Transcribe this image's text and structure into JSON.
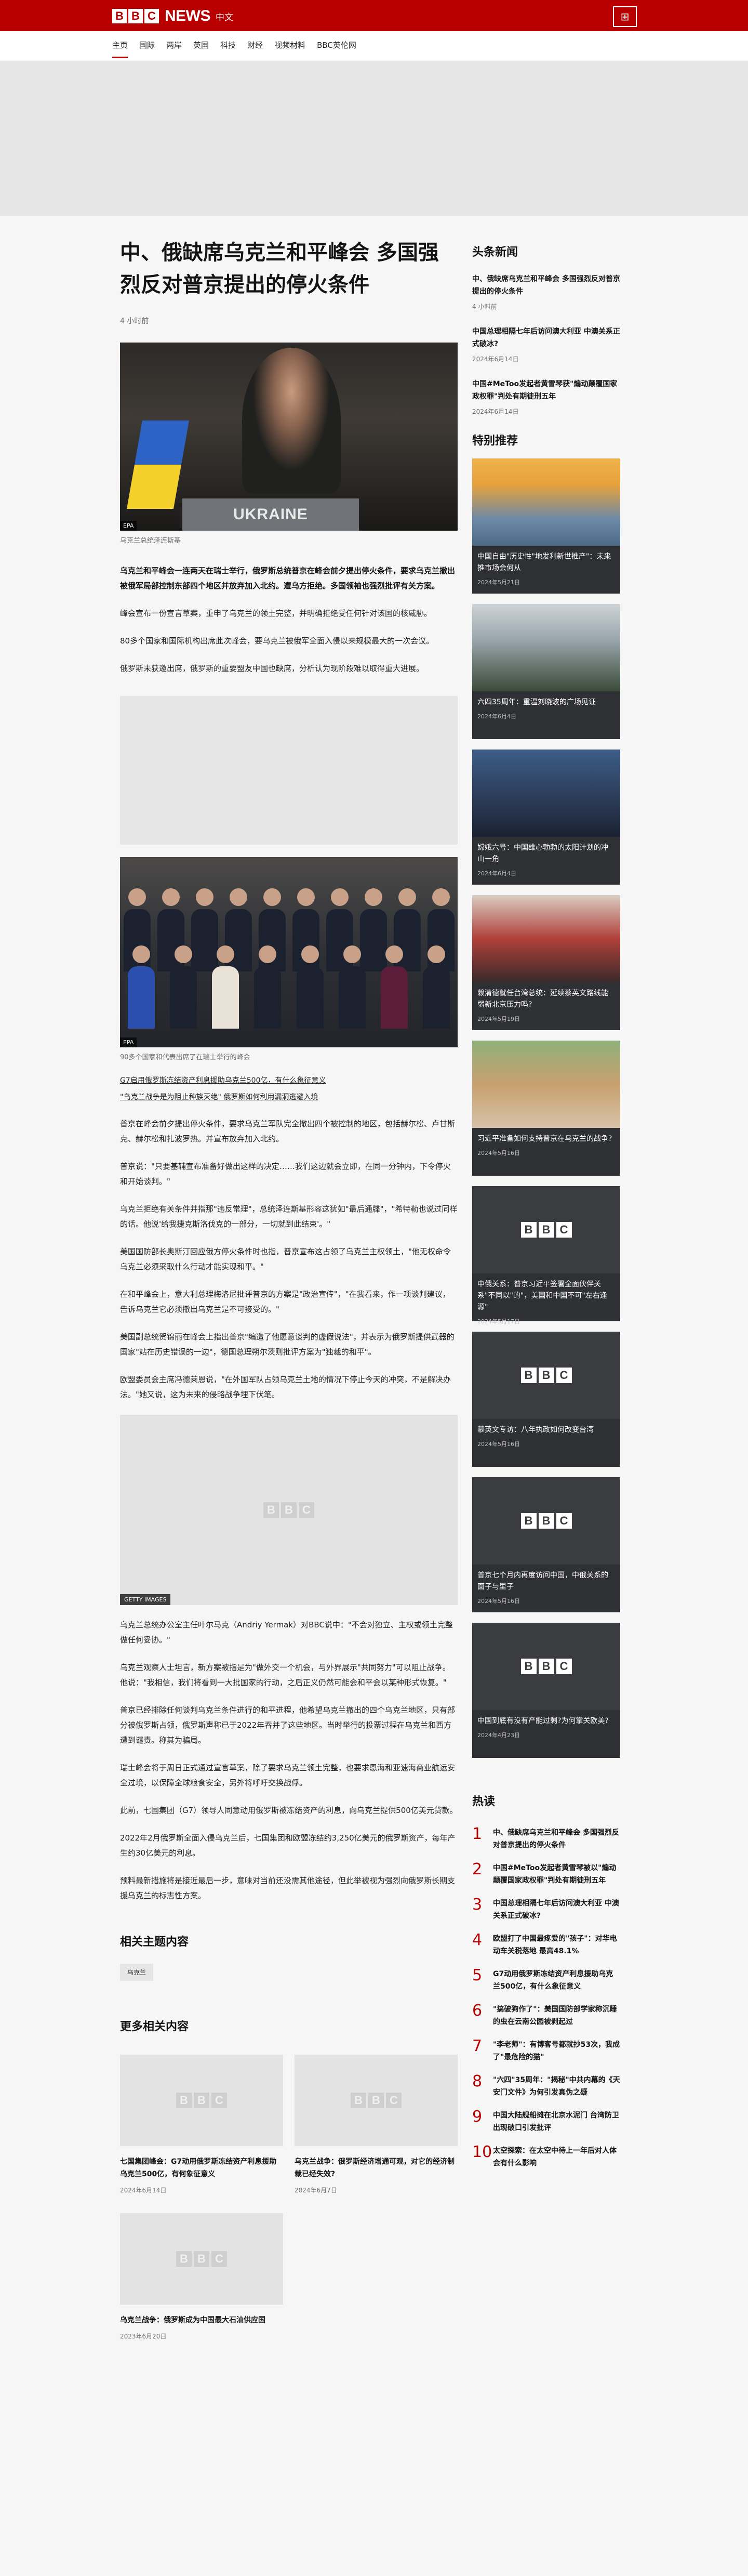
{
  "header": {
    "logo_letters": [
      "B",
      "B",
      "C"
    ],
    "logo_news": "NEWS",
    "logo_lang": "中文",
    "menu_icon": "grid-icon",
    "brand_color": "#b80000"
  },
  "nav": {
    "items": [
      "主页",
      "国际",
      "两岸",
      "英国",
      "科技",
      "财经",
      "视频材料",
      "BBC英伦网"
    ],
    "active_index": 0
  },
  "article": {
    "headline": "中、俄缺席乌克兰和平峰会 多国强烈反对普京提出的停火条件",
    "timestamp": "4 小时前",
    "hero_credit": "EPA",
    "hero_podium_text": "UKRAINE",
    "hero_caption": "乌克兰总统泽连斯基",
    "lead": "乌克兰和平峰会一连两天在瑞士举行，俄罗斯总统普京在峰会前夕提出停火条件，要求乌克兰撤出被俄军局部控制东部四个地区并放弃加入北约。遭乌方拒绝。多国领袖也强烈批评有关方案。",
    "paras_1": [
      "峰会宣布一份宣言草案，重申了乌克兰的领土完整，并明确拒绝受任何针对该国的核威胁。",
      "80多个国家和国际机构出席此次峰会，要乌克兰被俄军全面入侵以来规模最大的一次会议。",
      "俄罗斯未获邀出席，俄罗斯的重要盟友中国也缺席，分析认为现阶段难以取得重大进展。"
    ],
    "group_credit": "EPA",
    "group_caption": "90多个国家和代表出席了在瑞士举行的峰会",
    "bullets": [
      "G7启用俄罗斯冻结资产利息援助乌克兰500亿，有什么象征意义",
      "\"乌克兰战争是为阻止种族灭绝\" 俄罗斯如何利用漏洞逃避入境"
    ],
    "paras_2": [
      "普京在峰会前夕提出停火条件，要求乌克兰军队完全撤出四个被控制的地区，包括赫尔松、卢甘斯克、赫尔松和扎波罗热。并宣布放弃加入北约。",
      "普京说：\"只要基辅宣布准备好做出这样的决定……我们这边就会立即，在同一分钟内，下令停火和开始谈判。\"",
      "乌克兰拒绝有关条件并指那\"违反常理\"，总统泽连斯基形容这犹如\"最后通牒\"，\"希特勒也说过同样的话。他说'给我捷克斯洛伐克的一部分，一切就到此结束'。\"",
      "美国国防部长奥斯汀回应俄方停火条件时也指，普京宣布这占领了乌克兰主权领土，\"他无权命令乌克兰必须采取什么行动才能实现和平。\"",
      "在和平峰会上，意大利总理梅洛尼批评普京的方案是\"政治宣传\"，\"在我看来，作一项谈判建议，告诉乌克兰它必须撤出乌克兰是不可接受的。\"",
      "美国副总统贺锦丽在峰会上指出普京\"编造了他愿意谈判的虚假说法\"，并表示为俄罗斯提供武器的国家\"站在历史错误的一边\"，德国总理朔尔茨则批评方案为\"独裁的和平\"。",
      "欧盟委员会主席冯德莱恩说，\"在外国军队占领乌克兰土地的情况下停止今天的冲突，不是解决办法。\"她又说，这为未来的侵略战争埋下伏笔。"
    ],
    "getty_credit": "GETTY IMAGES",
    "paras_3": [
      "乌克兰总统办公室主任叶尔马克（Andriy Yermak）对BBC说中：\"不会对独立、主权或领土完整做任何妥协。\"",
      "乌克兰观察人士坦言，新方案被指是为\"做外交一个机会，与外界展示\"共同努力\"可以阻止战争。他说：\"我相信，我们将看到一大批国家的行动，之后正义仍然可能会和平会以某种形式恢复。\"",
      "普京已经排除任何谈判乌克兰条件进行的和平进程，他希望乌克兰撤出的四个乌克兰地区，只有部分被俄罗斯占领，俄罗斯声称已于2022年吞并了这些地区。当时举行的投票过程在乌克兰和西方遭到谴责。称其为骗局。",
      "瑞士峰会将于周日正式通过宣言草案，除了要求乌克兰领土完整，也要求恩海和亚速海商业航运安全过境，以保障全球粮食安全，另外将呼吁交换战俘。",
      "此前，七国集团（G7）领导人同意动用俄罗斯被冻结资产的利息，向乌克兰提供500亿美元贷款。",
      "2022年2月俄罗斯全面入侵乌克兰后，七国集团和欧盟冻结约3,250亿美元的俄罗斯资产，每年产生约30亿美元的利息。",
      "预料最新措施将是接近最后一步，意味对当前还没需其他途径，但此举被视为强烈向俄罗斯长期支援乌克兰的标志性方案。"
    ]
  },
  "topics": {
    "title": "相关主题内容",
    "tags": [
      "乌克兰"
    ]
  },
  "related": {
    "title": "更多相关内容",
    "items": [
      {
        "title": "七国集团峰会：G7动用俄罗斯冻结资产利息援助乌克兰500亿，有何象征意义",
        "date": "2024年6月14日"
      },
      {
        "title": "乌克兰战争：俄罗斯经济增通可观，对它的经济制裁已经失效?",
        "date": "2024年6月7日"
      },
      {
        "title": "乌克兰战争：俄罗斯成为中国最大石油供应国",
        "date": "2023年6月20日"
      }
    ]
  },
  "sidebar": {
    "headlines_title": "头条新闻",
    "headlines": [
      {
        "title": "中、俄缺席乌克兰和平峰会 多国强烈反对普京提出的停火条件",
        "date": "4 小时前"
      },
      {
        "title": "中国总理相隔七年后访问澳大利亚 中澳关系正式破冰?",
        "date": "2024年6月14日"
      },
      {
        "title": "中国#MeToo发起者黄雪琴获\"煽动颠覆国家政权罪\"判处有期徒刑五年",
        "date": "2024年6月14日"
      }
    ],
    "features_title": "特别推荐",
    "features": [
      {
        "title": "中国自由\"历史性\"地发利新世推产\"：未来推市场会何从",
        "date": "2024年5月21日",
        "image": "photo"
      },
      {
        "title": "六四35周年：重温刘晓波的广场见证",
        "date": "2024年6月4日",
        "image": "photo"
      },
      {
        "title": "嫦娥六号：中国雄心勃勃的太阳计划的冲山一角",
        "date": "2024年6月4日",
        "image": "photo"
      },
      {
        "title": "赖清德就任台湾总统：延续蔡英文路线能弱新北京压力吗?",
        "date": "2024年5月19日",
        "image": "photo"
      },
      {
        "title": "习近平准备如何支持普京在乌克兰的战争?",
        "date": "2024年5月16日",
        "image": "photo"
      },
      {
        "title": "中俄关系：普京习近平签署全面伙伴关系\"不同以\"的\"，美国和中国不可\"左右逢源\"",
        "date": "2024年5月17日",
        "image": "bbc"
      },
      {
        "title": "慕英文专访：八年执政如何改变台湾",
        "date": "2024年5月16日",
        "image": "bbc"
      },
      {
        "title": "普京七个月内再度访问中国，中俄关系的面子与里子",
        "date": "2024年5月16日",
        "image": "bbc"
      },
      {
        "title": "中国到底有没有产能过剩?为何掌关欧美?",
        "date": "2024年4月23日",
        "image": "bbc"
      }
    ],
    "hot_title": "热读",
    "hot": [
      "中、俄缺席乌克兰和平峰会 多国强烈反对普京提出的停火条件",
      "中国#MeToo发起者黄雪琴被以\"煽动颠覆国家政权罪\"判处有期徒刑五年",
      "中国总理相隔七年后访问澳大利亚 中澳关系正式破冰?",
      "欧盟打了中国最疼爱的\"孩子\"：对华电动车关税落地 最高48.1%",
      "G7动用俄罗斯冻结资产利息援助乌克兰500亿，有什么象征意义",
      "\"搞破狗作了\"：美国国防部学家称沉睡的虫在云南公园被剥起过",
      "\"李老师\"：有博客号都就抄53次，我成了\"最危险的猫\"",
      "\"六四\"35周年：\"揭秘\"中共内幕的《天安门文件》为何引发真伪之疑",
      "中国大陆舰船摊在北京水泥门 台湾防卫出现破口引发批评",
      "太空探索：在太空中待上一年后对人体会有什么影响"
    ]
  }
}
